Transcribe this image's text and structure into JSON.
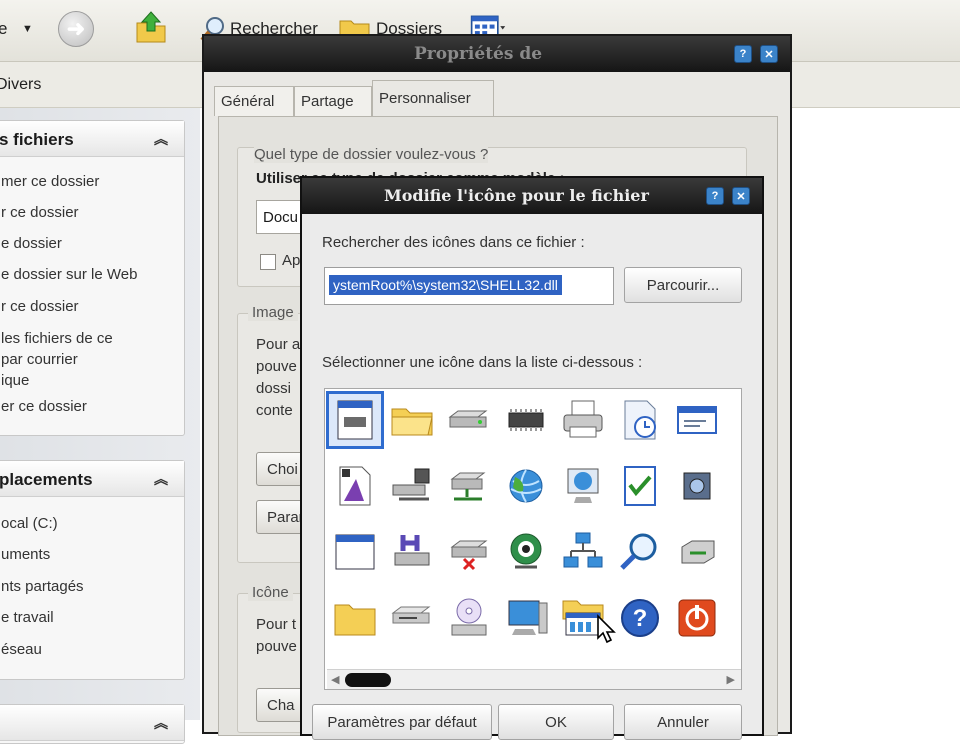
{
  "explorer": {
    "toolbar": {
      "back_label": "e",
      "search_label": "Rechercher",
      "folders_label": "Dossiers"
    },
    "address_text": "Divers",
    "tasks_panel": {
      "title": "s fichiers",
      "links": [
        "mer ce dossier",
        "r ce dossier",
        "e dossier",
        "e dossier sur le Web",
        "r ce dossier",
        "les fichiers de ce",
        "par courrier",
        "ique",
        "er ce dossier"
      ]
    },
    "places_panel": {
      "title": "placements",
      "links": [
        "ocal (C:)",
        "uments",
        "nts partagés",
        "e travail",
        "éseau"
      ]
    }
  },
  "properties_dialog": {
    "title": "Propriétés de",
    "tabs": [
      "Général",
      "Partage",
      "Personnaliser"
    ],
    "active_tab": "Personnaliser",
    "question": "Quel type de dossier voulez-vous ?",
    "template_label": "Utiliser ce type de dossier comme modèle :",
    "template_value": "Docu",
    "apply_label": "Ap",
    "images_group": "Image",
    "images_text": [
      "Pour a",
      "pouve",
      "dossi",
      "conte"
    ],
    "choose_btn": "Choi",
    "restore_btn": "Paran",
    "icons_group": "Icône",
    "icons_text": [
      "Pour t",
      "pouve"
    ],
    "change_btn": "Cha"
  },
  "change_icon_dialog": {
    "title": "Modifie l'icône pour le fichier",
    "search_label": "Rechercher des icônes dans ce fichier :",
    "file_path": "ystemRoot%\\system32\\SHELL32.dll",
    "browse_button": "Parcourir...",
    "list_label": "Sélectionner une icône dans la liste ci-dessous :",
    "selected_index": 0,
    "icons": [
      "window-text-icon",
      "folder-icon",
      "drive-icon",
      "memory-chip-icon",
      "printer-icon",
      "scheduled-task-icon",
      "window-card-icon",
      "partial-icon",
      "document-shortcut-icon",
      "network-drive-icon",
      "network-server-icon",
      "internet-globe-icon",
      "world-monitor-icon",
      "checked-document-icon",
      "speaker-cube-icon",
      "partial-icon",
      "blank-window-icon",
      "help-hard-drive-icon",
      "drive-removed-icon",
      "globe-network-icon",
      "network-neighborhood-icon",
      "magnifier-icon",
      "network-card-icon",
      "partial-icon",
      "plain-folder-icon",
      "floppy-drive-icon",
      "cd-drive-icon",
      "computer-icon",
      "folder-details-icon",
      "help-icon",
      "power-icon",
      "partial-icon"
    ],
    "buttons": {
      "defaults": "Paramètres par défaut",
      "ok": "OK",
      "cancel": "Annuler"
    }
  },
  "colors": {
    "selection_blue": "#2f63c3",
    "title_bar": "#151515",
    "title_button_blue": "#3b83c9"
  }
}
